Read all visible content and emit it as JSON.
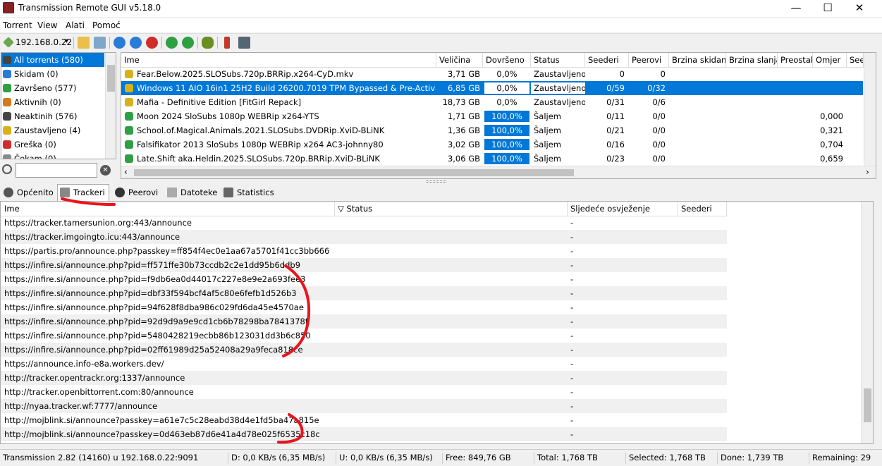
{
  "window": {
    "title": "Transmission Remote GUI v5.18.0",
    "minimize": "—",
    "maximize": "☐",
    "close": "✕"
  },
  "menu": [
    "Torrent",
    "View",
    "Alati",
    "Pomoć"
  ],
  "toolbar": {
    "host": "192.168.0.22",
    "dropdown": "▾"
  },
  "categories": [
    {
      "label": "All torrents (580)",
      "color": "#444444"
    },
    {
      "label": "Skidam (0)",
      "color": "#2a7bd8"
    },
    {
      "label": "Završeno (577)",
      "color": "#2ea043"
    },
    {
      "label": "Aktivnih (0)",
      "color": "#d27a1c"
    },
    {
      "label": "Neaktinih (576)",
      "color": "#444444"
    },
    {
      "label": "Zaustavljeno (4)",
      "color": "#d8b21c"
    },
    {
      "label": "Greška (0)",
      "color": "#d12c2c"
    },
    {
      "label": "Čekam (0)",
      "color": "#888888"
    }
  ],
  "torrents": {
    "columns": [
      "Ime",
      "Veličina",
      "Dovršeno",
      "Status",
      "Seederi",
      "Peerovi",
      "Brzina skidanja",
      "Brzina slanja",
      "Preostalo",
      "Omjer",
      "See"
    ],
    "rows": [
      {
        "name": "Fear.Below.2025.SLOSubs.720p.BRRip.x264-CyD.mkv",
        "size": "3,71 GB",
        "done": "0,0%",
        "progress": 0,
        "status": "Zaustavljeno",
        "seeds": "0",
        "peers": "0",
        "ratio": "",
        "icon": "#d8b21c"
      },
      {
        "name": "Windows 11 AIO 16in1 25H2 Build 26200.7019 TPM Bypassed & Pre-Activated {Ci",
        "size": "6,85 GB",
        "done": "0,0%",
        "progress": 0,
        "status": "Zaustavljeno",
        "seeds": "0/59",
        "peers": "0/32",
        "ratio": "",
        "icon": "#d8b21c",
        "selected": true
      },
      {
        "name": "Mafia - Definitive Edition [FitGirl Repack]",
        "size": "18,73 GB",
        "done": "0,0%",
        "progress": 0,
        "status": "Zaustavljeno",
        "seeds": "0/31",
        "peers": "0/6",
        "ratio": "",
        "icon": "#d8b21c"
      },
      {
        "name": "Moon 2024 SloSubs 1080p WEBRip x264-YTS",
        "size": "1,71 GB",
        "done": "100,0%",
        "progress": 1,
        "status": "Šaljem",
        "seeds": "0/11",
        "peers": "0/0",
        "ratio": "0,000",
        "icon": "#2ea043"
      },
      {
        "name": "School.of.Magical.Animals.2021.SLOSubs.DVDRip.XviD-BLiNK",
        "size": "1,36 GB",
        "done": "100,0%",
        "progress": 1,
        "status": "Šaljem",
        "seeds": "0/21",
        "peers": "0/0",
        "ratio": "0,321",
        "icon": "#2ea043"
      },
      {
        "name": "Falsifikator 2013 SloSubs 1080p WEBRip x264 AC3-johnny80",
        "size": "3,02 GB",
        "done": "100,0%",
        "progress": 1,
        "status": "Šaljem",
        "seeds": "0/16",
        "peers": "0/0",
        "ratio": "0,704",
        "icon": "#2ea043"
      },
      {
        "name": "Late.Shift aka.Heldin.2025.SLOSubs.720p.BRRip.XviD-BLiNK",
        "size": "3,06 GB",
        "done": "100,0%",
        "progress": 1,
        "status": "Šaljem",
        "seeds": "0/23",
        "peers": "0/0",
        "ratio": "0,659",
        "icon": "#2ea043"
      }
    ]
  },
  "tabs": [
    "Općenito",
    "Trackeri",
    "Peerovi",
    "Datoteke",
    "Statistics"
  ],
  "trackers": {
    "columns": [
      "Ime",
      "Status",
      "Sljedeće osvježenje",
      "Seederi"
    ],
    "sort_indicator": "▽",
    "rows": [
      {
        "url": "https://tracker.tamersunion.org:443/announce",
        "next": "-"
      },
      {
        "url": "https://tracker.imgoingto.icu:443/announce",
        "next": "-"
      },
      {
        "url": "https://partis.pro/announce.php?passkey=ff854f4ec0e1aa67a5701f41cc3bb666",
        "next": "-"
      },
      {
        "url": "https://infire.si/announce.php?pid=ff571ffe30b73ccdb2c2e1dd95b6ddb9",
        "next": "-"
      },
      {
        "url": "https://infire.si/announce.php?pid=f9db6ea0d44017c227e8e9e2a693fee3",
        "next": "-"
      },
      {
        "url": "https://infire.si/announce.php?pid=dbf33f594bcf4af5c80e6fefb1d526b3",
        "next": "-"
      },
      {
        "url": "https://infire.si/announce.php?pid=94f628f8dba986c029fd6da45e4570ae",
        "next": "-"
      },
      {
        "url": "https://infire.si/announce.php?pid=92d9d9a9e9cd1cb6b78298ba7841378f",
        "next": "-"
      },
      {
        "url": "https://infire.si/announce.php?pid=5480428219ecbb86b123031dd3b6c850",
        "next": "-"
      },
      {
        "url": "https://infire.si/announce.php?pid=02ff61989d25a52408a29a9feca818ce",
        "next": "-"
      },
      {
        "url": "https://announce.info-e8a.workers.dev/",
        "next": "-"
      },
      {
        "url": "http://tracker.opentrackr.org:1337/announce",
        "next": "-"
      },
      {
        "url": "http://tracker.openbittorrent.com:80/announce",
        "next": "-"
      },
      {
        "url": "http://nyaa.tracker.wf:7777/announce",
        "next": "-"
      },
      {
        "url": "http://mojblink.si/announce?passkey=a61e7c5c28eabd38d4e1fd5ba47a815e",
        "next": "-"
      },
      {
        "url": "http://mojblink.si/announce?passkey=0d463eb87d6e41a4d78e025f6535c18c",
        "next": "-"
      }
    ]
  },
  "statusbar": {
    "connection": "Transmission 2.82 (14160) u 192.168.0.22:9091",
    "download": "D: 0,0 KB/s (6,35 MB/s)",
    "upload": "U: 0,0 KB/s (6,35 MB/s)",
    "free": "Free: 849,76 GB",
    "total": "Total: 1,768 TB",
    "selected": "Selected: 1,768 TB",
    "done": "Done: 1,739 TB",
    "remaining": "Remaining: 29"
  },
  "colors": {
    "accent": "#0078d7",
    "annotation": "#e8151d"
  }
}
